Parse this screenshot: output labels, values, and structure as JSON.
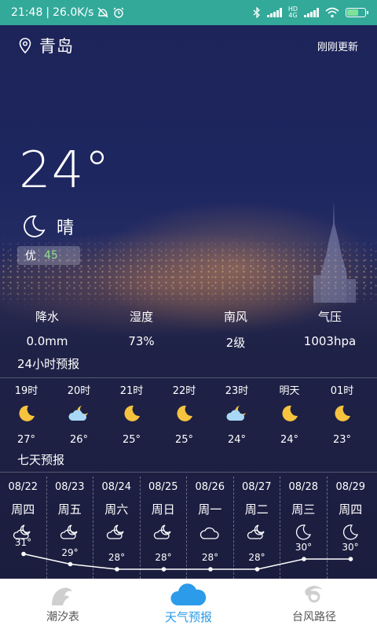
{
  "status_bar": {
    "time": "21:48",
    "speed": "26.0K/s",
    "network": "4G",
    "colors": {
      "background": "#33a99a",
      "battery_fill": "#7ee29a"
    }
  },
  "header": {
    "city": "青岛",
    "update_time": "刚刚更新",
    "icon": "location-pin-icon"
  },
  "current": {
    "temperature": "24°",
    "condition": "晴",
    "condition_icon": "moon-icon",
    "aqi_label": "优",
    "aqi_value": "45",
    "aqi_color": "#8be08a"
  },
  "stats": [
    {
      "label": "降水",
      "value": "0.0mm"
    },
    {
      "label": "湿度",
      "value": "73%"
    },
    {
      "label": "南风",
      "value": "2级"
    },
    {
      "label": "气压",
      "value": "1003hpa"
    }
  ],
  "hourly_title": "24小时预报",
  "hourly": [
    {
      "time": "19时",
      "icon": "moon-icon",
      "temp": "27°"
    },
    {
      "time": "20时",
      "icon": "cloudy-night-icon",
      "temp": "26°"
    },
    {
      "time": "21时",
      "icon": "moon-icon",
      "temp": "25°"
    },
    {
      "time": "22时",
      "icon": "moon-icon",
      "temp": "25°"
    },
    {
      "time": "23时",
      "icon": "cloudy-night-icon",
      "temp": "24°"
    },
    {
      "time": "明天",
      "icon": "moon-icon",
      "temp": "24°"
    },
    {
      "time": "01时",
      "icon": "moon-icon",
      "temp": "23°"
    }
  ],
  "daily_title": "七天预报",
  "daily": [
    {
      "date": "08/22",
      "weekday": "周四",
      "icon": "cloudy-night-outline-icon",
      "high": 31,
      "high_label": "31°"
    },
    {
      "date": "08/23",
      "weekday": "周五",
      "icon": "cloudy-night-outline-icon",
      "high": 29,
      "high_label": "29°"
    },
    {
      "date": "08/24",
      "weekday": "周六",
      "icon": "cloudy-night-outline-icon",
      "high": 28,
      "high_label": "28°"
    },
    {
      "date": "08/25",
      "weekday": "周日",
      "icon": "cloudy-night-outline-icon",
      "high": 28,
      "high_label": "28°"
    },
    {
      "date": "08/26",
      "weekday": "周一",
      "icon": "cloud-outline-icon",
      "high": 28,
      "high_label": "28°"
    },
    {
      "date": "08/27",
      "weekday": "周二",
      "icon": "cloudy-night-outline-icon",
      "high": 28,
      "high_label": "28°"
    },
    {
      "date": "08/28",
      "weekday": "周三",
      "icon": "moon-outline-icon",
      "high": 30,
      "high_label": "30°"
    },
    {
      "date": "08/29",
      "weekday": "周四",
      "icon": "moon-outline-icon",
      "high": 30,
      "high_label": "30°"
    }
  ],
  "tabbar": {
    "tabs": [
      {
        "label": "潮汐表",
        "icon": "wave-icon",
        "active": false
      },
      {
        "label": "天气预报",
        "icon": "cloud-icon",
        "active": true
      },
      {
        "label": "台风路径",
        "icon": "typhoon-icon",
        "active": false
      }
    ],
    "colors": {
      "active": "#2b9bea",
      "inactive": "#555555"
    }
  }
}
